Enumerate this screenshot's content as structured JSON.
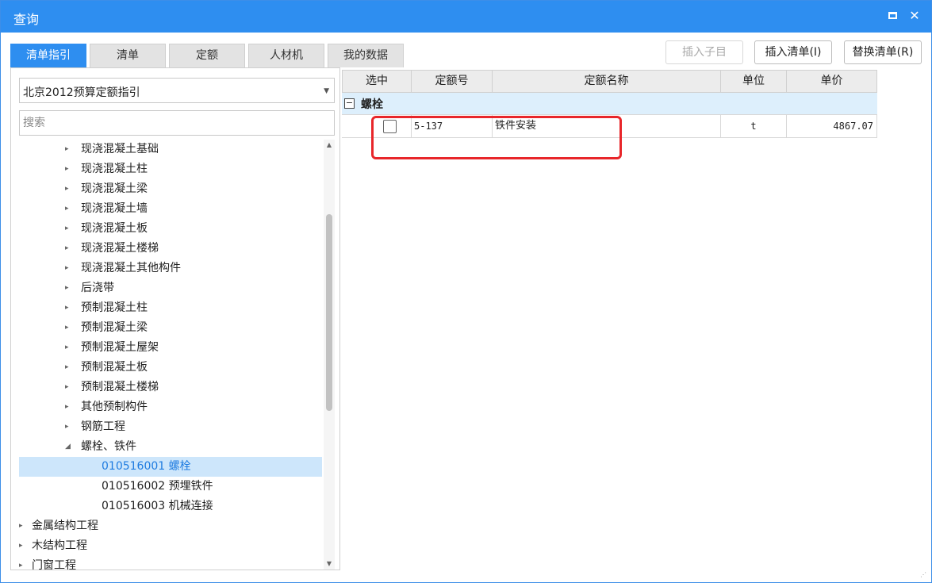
{
  "window": {
    "title": "查询",
    "maximize_icon": "maximize-icon",
    "close_label": "✕"
  },
  "tabs": [
    {
      "label": "清单指引",
      "active": true
    },
    {
      "label": "清单",
      "active": false
    },
    {
      "label": "定额",
      "active": false
    },
    {
      "label": "人材机",
      "active": false
    },
    {
      "label": "我的数据",
      "active": false
    }
  ],
  "toolbar": {
    "insert_child_label": "插入子目",
    "insert_list_label": "插入清单(I)",
    "replace_list_label": "替换清单(R)"
  },
  "left": {
    "guide_selected": "北京2012预算定额指引",
    "search_placeholder": "搜索",
    "tree": [
      {
        "label": "现浇混凝土基础",
        "level": 1,
        "state": "collapsed"
      },
      {
        "label": "现浇混凝土柱",
        "level": 1,
        "state": "collapsed"
      },
      {
        "label": "现浇混凝土梁",
        "level": 1,
        "state": "collapsed"
      },
      {
        "label": "现浇混凝土墙",
        "level": 1,
        "state": "collapsed"
      },
      {
        "label": "现浇混凝土板",
        "level": 1,
        "state": "collapsed"
      },
      {
        "label": "现浇混凝土楼梯",
        "level": 1,
        "state": "collapsed"
      },
      {
        "label": "现浇混凝土其他构件",
        "level": 1,
        "state": "collapsed"
      },
      {
        "label": "后浇带",
        "level": 1,
        "state": "collapsed"
      },
      {
        "label": "预制混凝土柱",
        "level": 1,
        "state": "collapsed"
      },
      {
        "label": "预制混凝土梁",
        "level": 1,
        "state": "collapsed"
      },
      {
        "label": "预制混凝土屋架",
        "level": 1,
        "state": "collapsed"
      },
      {
        "label": "预制混凝土板",
        "level": 1,
        "state": "collapsed"
      },
      {
        "label": "预制混凝土楼梯",
        "level": 1,
        "state": "collapsed"
      },
      {
        "label": "其他预制构件",
        "level": 1,
        "state": "collapsed"
      },
      {
        "label": "钢筋工程",
        "level": 1,
        "state": "collapsed"
      },
      {
        "label": "螺栓、铁件",
        "level": 1,
        "state": "expanded"
      },
      {
        "label": "010516001  螺栓",
        "level": 2,
        "state": "leaf",
        "selected": true
      },
      {
        "label": "010516002  预埋铁件",
        "level": 2,
        "state": "leaf"
      },
      {
        "label": "010516003  机械连接",
        "level": 2,
        "state": "leaf"
      },
      {
        "label": "金属结构工程",
        "level": 0,
        "state": "collapsed"
      },
      {
        "label": "木结构工程",
        "level": 0,
        "state": "collapsed"
      },
      {
        "label": "门窗工程",
        "level": 0,
        "state": "collapsed"
      }
    ]
  },
  "grid": {
    "columns": [
      "选中",
      "定额号",
      "定额名称",
      "单位",
      "单价"
    ],
    "group": {
      "toggle": "−",
      "label": "螺栓"
    },
    "rows": [
      {
        "checked": false,
        "code": "5-137",
        "name": "铁件安装",
        "unit": "t",
        "price": "4867.07"
      }
    ]
  },
  "colors": {
    "accent": "#2e8ef0",
    "selected_row_bg": "#cde6fb",
    "highlight_border": "#e8262a"
  }
}
